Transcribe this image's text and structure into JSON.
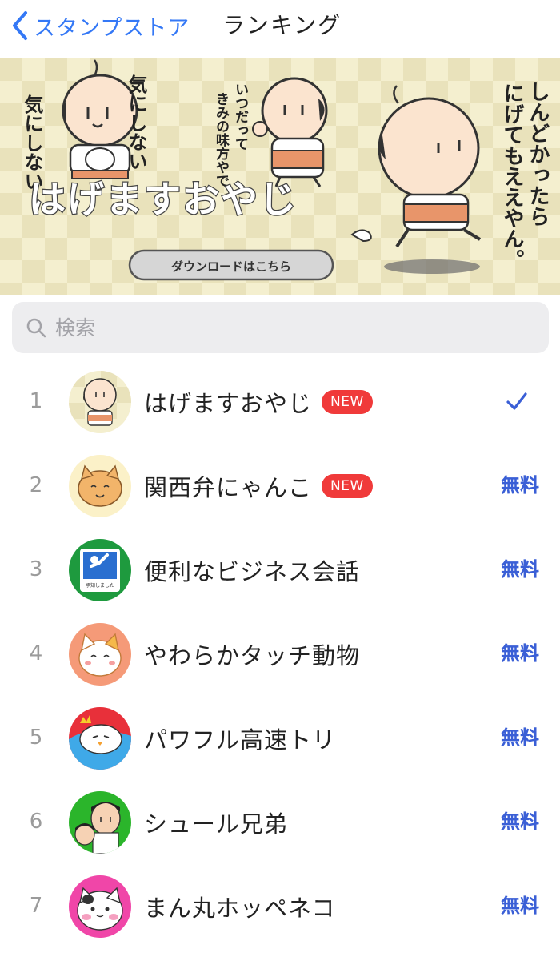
{
  "nav": {
    "back_label": "スタンプストア",
    "title": "ランキング"
  },
  "banner": {
    "title": "はげますおやじ",
    "download_label": "ダウンロードはこちら",
    "phrase_1a": "気にしない",
    "phrase_1b": "気にしない",
    "phrase_2a": "いつだって",
    "phrase_2b": "きみの味方やで",
    "phrase_3a": "しんどかったら",
    "phrase_3b": "にげてもええやん。"
  },
  "search": {
    "placeholder": "検索",
    "icon": "magnifier-icon"
  },
  "colors": {
    "accent": "#3478f6",
    "price": "#3a5fd6",
    "badge": "#f03a3a"
  },
  "ranking": [
    {
      "rank": "1",
      "name": "はげますおやじ",
      "badge": "NEW",
      "status": "owned",
      "icon": "checkmark-icon"
    },
    {
      "rank": "2",
      "name": "関西弁にゃんこ",
      "badge": "NEW",
      "price": "無料"
    },
    {
      "rank": "3",
      "name": "便利なビジネス会話",
      "price": "無料",
      "thumb_text": "承知しました"
    },
    {
      "rank": "4",
      "name": "やわらかタッチ動物",
      "price": "無料"
    },
    {
      "rank": "5",
      "name": "パワフル高速トリ",
      "price": "無料"
    },
    {
      "rank": "6",
      "name": "シュール兄弟",
      "price": "無料"
    },
    {
      "rank": "7",
      "name": "まん丸ホッペネコ",
      "price": "無料"
    }
  ]
}
